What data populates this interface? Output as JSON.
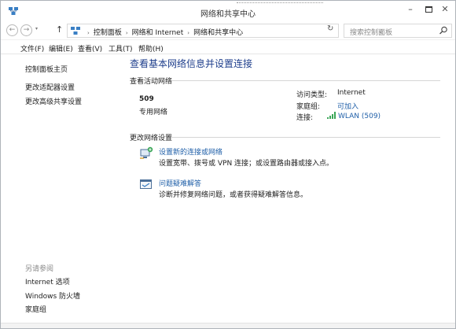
{
  "window": {
    "title": "网络和共享中心",
    "buttons": {
      "minimize": "–",
      "close": "✕"
    }
  },
  "addressbar": {
    "back": "←",
    "forward": "→",
    "history": "▾",
    "up": "↑",
    "breadcrumbs": [
      "控制面板",
      "网络和 Internet",
      "网络和共享中心"
    ],
    "separator": "›",
    "dropdown": "⌄",
    "refresh": "↻",
    "search_placeholder": "搜索控制面板"
  },
  "menubar": {
    "items": [
      "文件(F)",
      "编辑(E)",
      "查看(V)",
      "工具(T)",
      "帮助(H)"
    ]
  },
  "sidebar": {
    "links": [
      "控制面板主页",
      "更改适配器设置",
      "更改高级共享设置"
    ],
    "see_also_heading": "另请参阅",
    "see_also": [
      "Internet 选项",
      "Windows 防火墙",
      "家庭组"
    ]
  },
  "main": {
    "title": "查看基本网络信息并设置连接",
    "active_heading": "查看活动网络",
    "network": {
      "name": "509",
      "type": "专用网络",
      "access_type_label": "访问类型:",
      "access_type_value": "Internet",
      "homegroup_label": "家庭组:",
      "homegroup_value": "可加入",
      "connections_label": "连接:",
      "connections_value": "WLAN (509)"
    },
    "change_heading": "更改网络设置",
    "tasks": [
      {
        "title": "设置新的连接或网络",
        "desc": "设置宽带、拨号或 VPN 连接；或设置路由器或接入点。",
        "icon": "new-connection-icon"
      },
      {
        "title": "问题疑难解答",
        "desc": "诊断并修复网络问题，或者获得疑难解答信息。",
        "icon": "troubleshoot-icon"
      }
    ]
  },
  "colors": {
    "link": "#1f5fa8",
    "title": "#1e3e8c",
    "muted": "#8a8a8a"
  }
}
